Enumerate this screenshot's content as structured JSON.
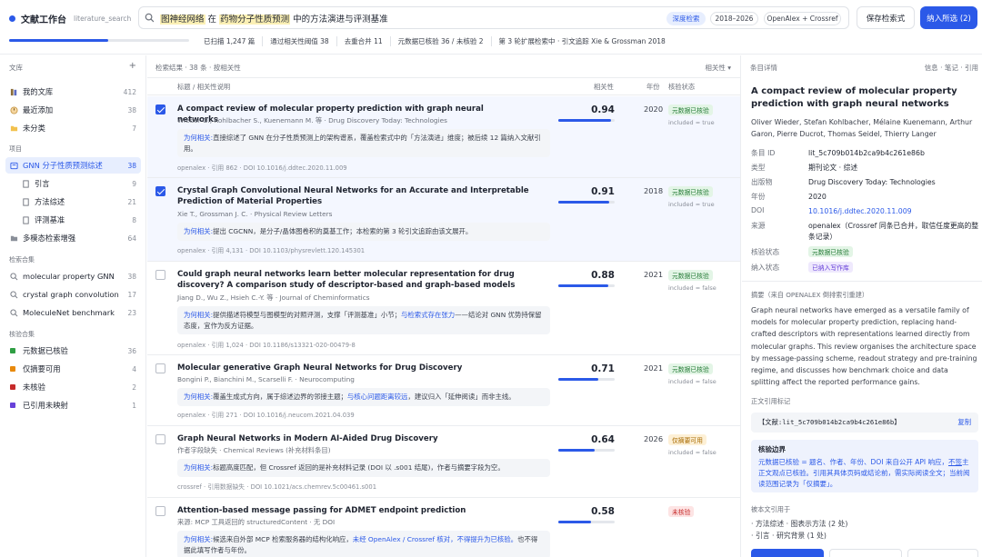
{
  "app": {
    "title": "文献工作台",
    "subtitle": "literature_search"
  },
  "search": {
    "q1": "图神经网络",
    "q2": " 在 ",
    "q3": "药物分子性质预测",
    "q4": " 中的方法演进与评测基准"
  },
  "chips": [
    "深度检索",
    "2018–2026",
    "OpenAlex + Crossref"
  ],
  "buttons": {
    "save": "保存检索式",
    "add": "纳入所选 (2)"
  },
  "progress": 0.55,
  "stats": [
    "已扫描 1,247 篇",
    "通过相关性阈值 38",
    "去重合并 11",
    "元数据已核验 36 / 未核验 2",
    "第 3 轮扩展检索中 · 引文追踪 Xie & Grossman 2018"
  ],
  "sidebar": {
    "header": "文库",
    "plus": "+",
    "lib": [
      {
        "label": "我的文库",
        "count": "412"
      },
      {
        "label": "最近添加",
        "count": "38"
      },
      {
        "label": "未分类",
        "count": "7"
      }
    ],
    "proj_title": "项目",
    "proj": {
      "label": "GNN 分子性质预测综述",
      "count": "38"
    },
    "subs": [
      {
        "label": "引言",
        "count": "9"
      },
      {
        "label": "方法综述",
        "count": "21"
      },
      {
        "label": "评测基准",
        "count": "8"
      }
    ],
    "proj2": {
      "label": "多模态检索增强",
      "count": "64"
    },
    "q_title": "检索合集",
    "queries": [
      {
        "label": "molecular property GNN",
        "count": "38"
      },
      {
        "label": "crystal graph convolution",
        "count": "17"
      },
      {
        "label": "MoleculeNet benchmark",
        "count": "23"
      }
    ],
    "v_title": "核验合集",
    "verify": [
      {
        "label": "元数据已核验",
        "count": "36",
        "color": "#2f9e44"
      },
      {
        "label": "仅摘要可用",
        "count": "4",
        "color": "#e8890c"
      },
      {
        "label": "未核验",
        "count": "2",
        "color": "#c62a2a"
      },
      {
        "label": "已引用未映射",
        "count": "1",
        "color": "#6741d9"
      }
    ]
  },
  "results": {
    "header": "检索结果 · 38 条 · 按相关性",
    "sort": "相关性 ▾",
    "cols": {
      "title": "标题 / 相关性说明",
      "rel": "相关性",
      "year": "年份",
      "status": "核验状态"
    },
    "rows": [
      {
        "title": "A compact review of molecular property prediction with graph neural networks",
        "meta": "Wieder O., Kohlbacher S., Kuenemann M. 等 · Drug Discovery Today: Technologies",
        "why_l": "为何相关:",
        "why": "直接综述了 GNN 在分子性质预测上的架构谱系，覆盖检索式中的「方法演进」维度；被后续 12 篇纳入文献引用。",
        "src": "openalex · 引用 862 · DOI 10.1016/j.ddtec.2020.11.009",
        "score": "0.94",
        "s": 0.94,
        "year": "2020",
        "badge": "元数据已核验",
        "incl": "included = true"
      },
      {
        "title": "Crystal Graph Convolutional Neural Networks for an Accurate and Interpretable Prediction of Material Properties",
        "meta": "Xie T., Grossman J. C. · Physical Review Letters",
        "why_l": "为何相关:",
        "why": "提出 CGCNN，是分子/晶体图卷积的奠基工作；本检索的第 3 轮引文追踪由该文展开。",
        "src": "openalex · 引用 4,131 · DOI 10.1103/physrevlett.120.145301",
        "score": "0.91",
        "s": 0.91,
        "year": "2018",
        "badge": "元数据已核验",
        "incl": "included = true"
      },
      {
        "title": "Could graph neural networks learn better molecular representation for drug discovery? A comparison study of descriptor-based and graph-based models",
        "meta": "Jiang D., Wu Z., Hsieh C.-Y. 等 · Journal of Cheminformatics",
        "why_l": "为何相关:",
        "why_a": "提供描述符模型与图模型的对照评测，支撑「评测基准」小节；",
        "why_b": "与检索式存在张力",
        "why_c": "——结论对 GNN 优势持保留态度，宜作为反方证据。",
        "src": "openalex · 引用 1,024 · DOI 10.1186/s13321-020-00479-8",
        "score": "0.88",
        "s": 0.88,
        "year": "2021",
        "badge": "元数据已核验",
        "incl": "included = false"
      },
      {
        "title": "Molecular generative Graph Neural Networks for Drug Discovery",
        "meta": "Bongini P., Bianchini M., Scarselli F. · Neurocomputing",
        "why_l": "为何相关:",
        "why_a": "覆盖生成式方向，属于综述边界的邻接主题；",
        "why_b": "与核心问题距离较远",
        "why_c": "，建议归入「延伸阅读」而非主线。",
        "src": "openalex · 引用 271 · DOI 10.1016/j.neucom.2021.04.039",
        "score": "0.71",
        "s": 0.71,
        "year": "2021",
        "badge": "元数据已核验",
        "incl": "included = false"
      },
      {
        "title": "Graph Neural Networks in Modern AI-Aided Drug Discovery",
        "meta": "作者字段缺失 · Chemical Reviews (补充材料条目)",
        "why_l": "为何相关:",
        "why": "标题高度匹配，但 Crossref 返回的是补充材料记录 (DOI 以 .s001 结尾)，作者与摘要字段为空。",
        "src": "crossref · 引用数据缺失 · DOI 10.1021/acs.chemrev.5c00461.s001",
        "score": "0.64",
        "s": 0.64,
        "year": "2026",
        "badge": "仅摘要可用",
        "incl": "included = false"
      },
      {
        "title": "Attention-based message passing for ADMET endpoint prediction",
        "meta": "来源: MCP 工具返回的 structuredContent · 无 DOI",
        "why_l": "为何相关:",
        "why_a": "候选来自外部 MCP 检索服务器的结构化响应，",
        "why_b": "未经 OpenAlex / Crossref 核对，不得提升为已核验。",
        "why_c": "也不得据此填写作者与年份。",
        "score": "0.58",
        "s": 0.58,
        "year": "",
        "badge": "未核验",
        "incl": ""
      }
    ]
  },
  "detail": {
    "header": "条目详情",
    "tabs": "信息 · 笔记 · 引用",
    "title": "A compact review of molecular property prediction with graph neural networks",
    "authors": "Oliver Wieder, Stefan Kohlbacher, Mélaine Kuenemann, Arthur Garon, Pierre Ducrot, Thomas Seidel, Thierry Langer",
    "fields": [
      {
        "k": "条目 ID",
        "v": "lit_5c709b014b2ca9b4c261e86b"
      },
      {
        "k": "类型",
        "v": "期刊论文 · 综述"
      },
      {
        "k": "出版物",
        "v": "Drug Discovery Today: Technologies"
      },
      {
        "k": "年份",
        "v": "2020"
      },
      {
        "k": "DOI",
        "v": "10.1016/j.ddtec.2020.11.009"
      },
      {
        "k": "来源",
        "v": "openalex（Crossref 同条已合并，取信任度更高的整条记录）"
      }
    ],
    "verify_k": "核验状态",
    "verify_v": "元数据已核验",
    "incl_k": "纳入状态",
    "incl_v": "已纳入写作库",
    "abs_head": "摘要（来自 OPENALEX 倒排索引重建）",
    "abstract": "Graph neural networks have emerged as a versatile family of models for molecular property prediction, replacing hand-crafted descriptors with representations learned directly from molecular graphs. This review organises the architecture space by message-passing scheme, readout strategy and pre-training regime, and discusses how benchmark choice and data splitting affect the reported performance gains.",
    "cite_head": "正文引用标记",
    "cite": "【文献:lit_5c709b014b2ca9b4c261e86b】",
    "copy": "复制",
    "bound_title": "核验边界",
    "bound_a": "元数据已核验 = 题名、作者、年份、DOI 来自公开 API 响应，",
    "bound_u": "不签",
    "bound_b": "主正文观点已核验。引用其具体页码或结论前，需实际阅读全文；当前阅读范围记录为「仅摘要」。",
    "ref_head": "被本文引用于",
    "refs": [
      "· 方法综述 · 图表示方法 (2 处)",
      "· 引言 · 研究背景 (1 处)"
    ]
  },
  "colors": {
    "accent": "#2b59e8",
    "verified": "#237a35",
    "abstract_only": "#a86a00",
    "unverified": "#c62a2a"
  }
}
